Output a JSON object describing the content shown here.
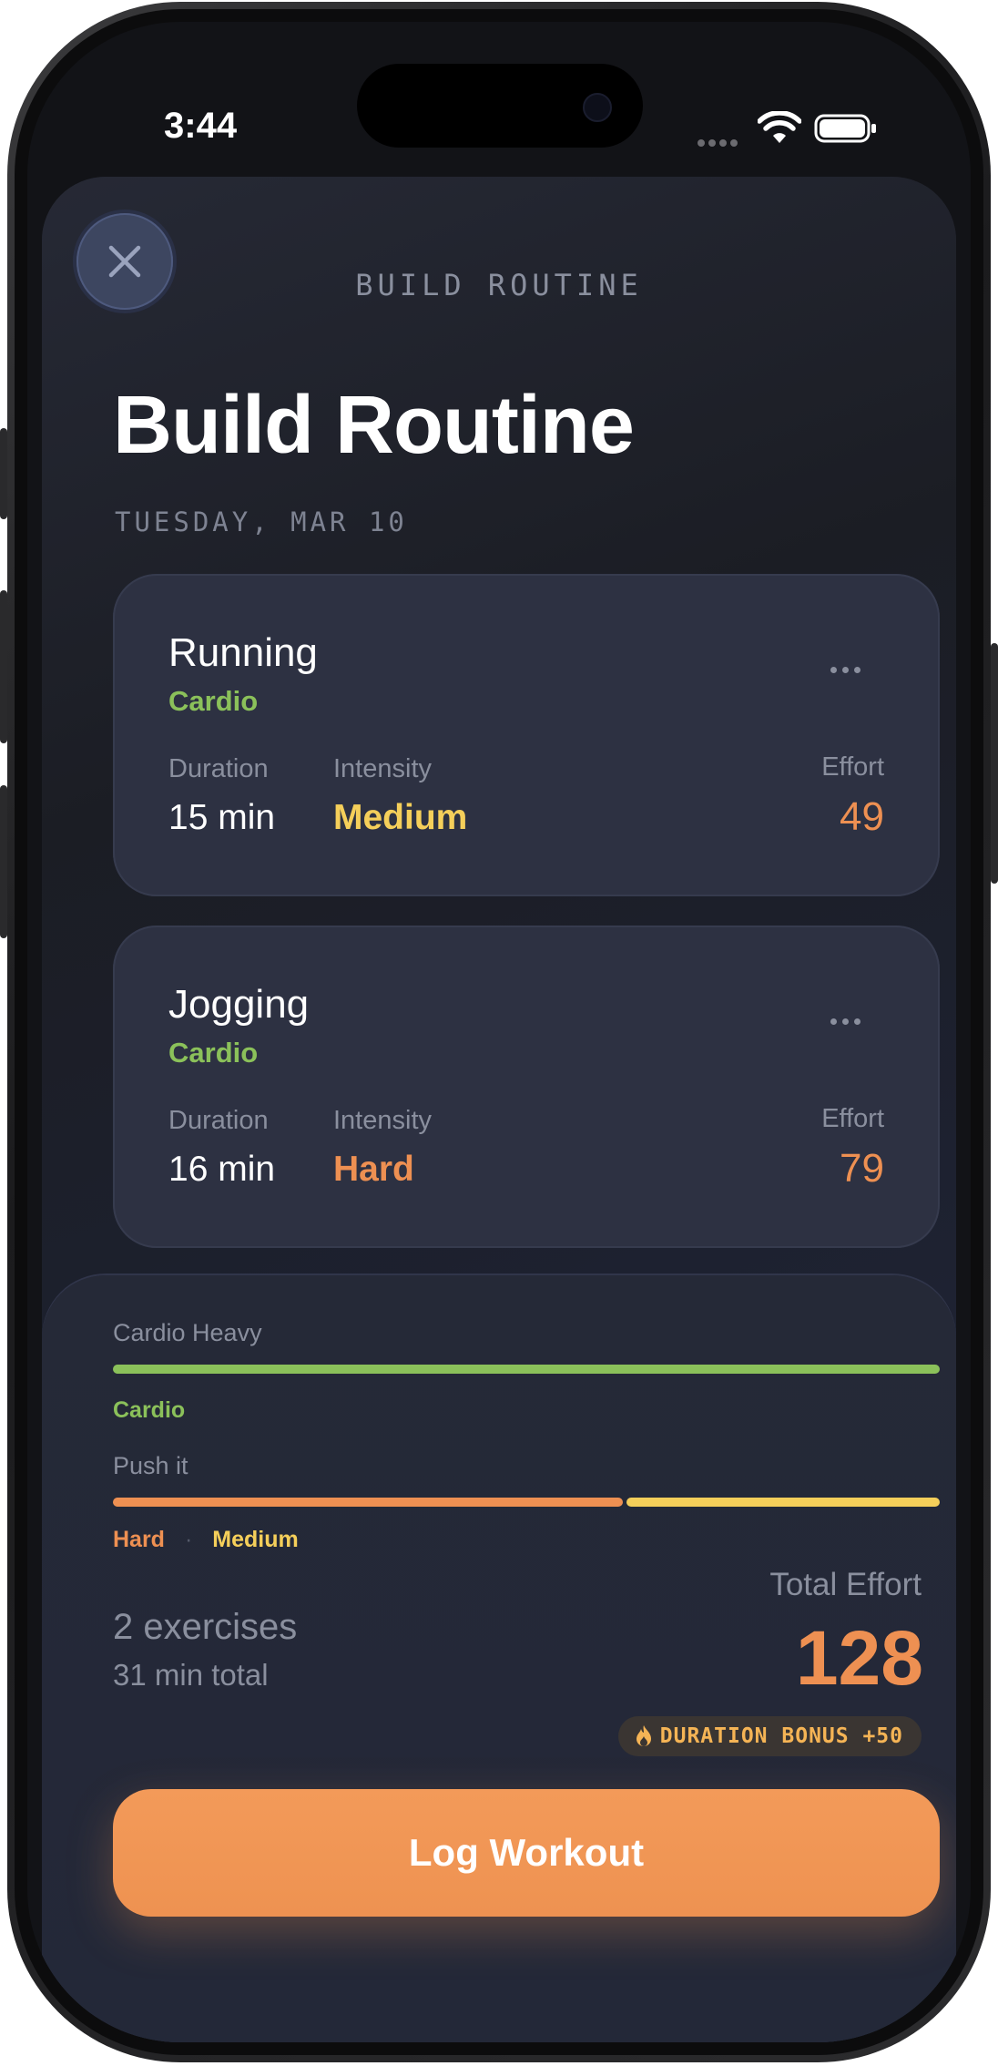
{
  "status_bar": {
    "time": "3:44"
  },
  "header": {
    "small_title": "BUILD ROUTINE",
    "title": "Build Routine",
    "date": "TUESDAY, MAR 10"
  },
  "exercises": [
    {
      "name": "Running",
      "category": "Cardio",
      "duration_label": "Duration",
      "duration": "15 min",
      "intensity_label": "Intensity",
      "intensity": "Medium",
      "effort_label": "Effort",
      "effort": "49"
    },
    {
      "name": "Jogging",
      "category": "Cardio",
      "duration_label": "Duration",
      "duration": "16 min",
      "intensity_label": "Intensity",
      "intensity": "Hard",
      "effort_label": "Effort",
      "effort": "79"
    }
  ],
  "summary": {
    "category_bar_label": "Cardio Heavy",
    "category_legend": [
      "Cardio"
    ],
    "intensity_bar_label": "Push it",
    "intensity_legend": [
      "Hard",
      "Medium"
    ],
    "intensity_split": {
      "Hard": 0.62,
      "Medium": 0.38
    },
    "exercise_count": "2 exercises",
    "total_time": "31 min total",
    "total_effort_label": "Total Effort",
    "total_effort": "128",
    "bonus": "DURATION BONUS +50"
  },
  "action": {
    "log_label": "Log Workout"
  },
  "colors": {
    "cardio": "#8bc15a",
    "medium": "#f5cf5a",
    "hard": "#ee9052",
    "accent": "#ee9052"
  }
}
